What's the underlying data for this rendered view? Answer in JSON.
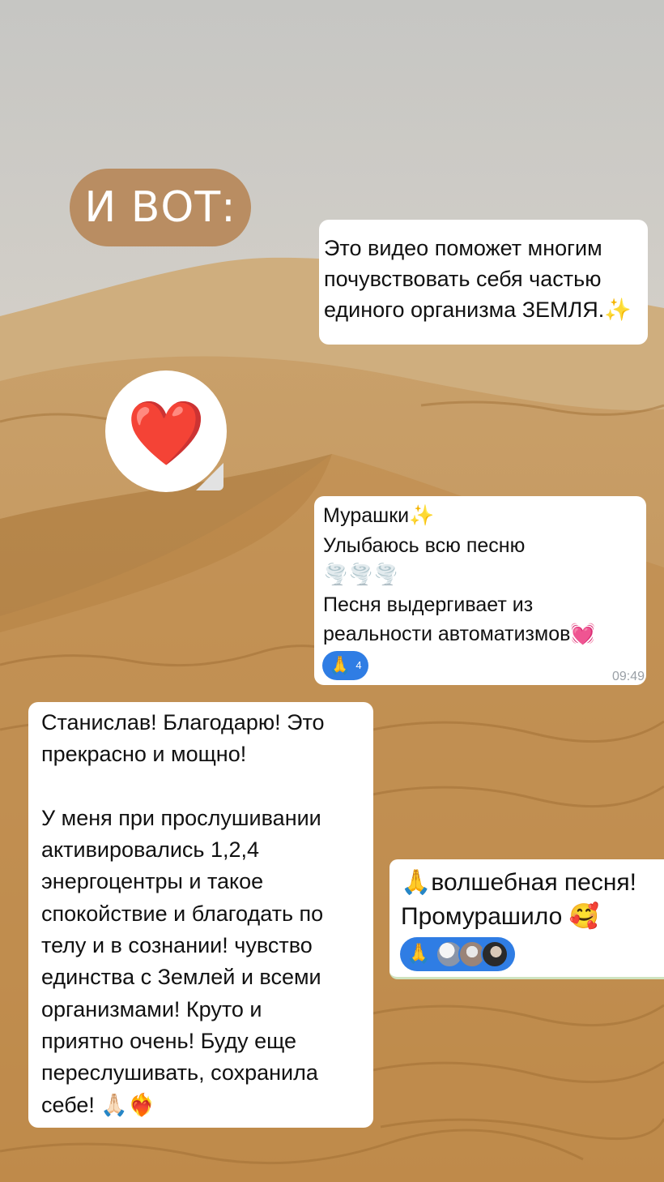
{
  "story_tag": "И ВОТ:",
  "sticker": {
    "icon": "red-heart-icon",
    "glyph": "❤️"
  },
  "message1": {
    "lines": [
      "Это видео поможет многим",
      "почувствовать себя частью",
      "единого организма ЗЕМЛЯ.✨"
    ]
  },
  "message2": {
    "lines": [
      "Мурашки✨",
      "Улыбаюсь всю песню",
      "🌪️🌪️🌪️",
      "Песня выдергивает из",
      "реальности автоматизмов💓"
    ],
    "reaction": {
      "emoji": "🙏",
      "count": "4"
    },
    "time": "09:49"
  },
  "message3": {
    "paragraph1": [
      "Станислав! Благодарю! Это",
      "прекрасно и мощно!"
    ],
    "paragraph2": [
      "У меня при прослушивании",
      "активировались 1,2,4",
      "энергоцентры и такое",
      "спокойствие и благодать по",
      "телу и в сознании! чувство",
      "единства с Землей и всеми",
      "организмами! Круто и",
      "приятно очень! Буду еще",
      "переслушивать, сохранила",
      "себе! 🙏🏻❤️‍🔥"
    ]
  },
  "message4": {
    "lines": [
      "🙏волшебная песня!",
      "Промурашило 🥰"
    ],
    "reaction": {
      "emoji": "🙏"
    }
  }
}
